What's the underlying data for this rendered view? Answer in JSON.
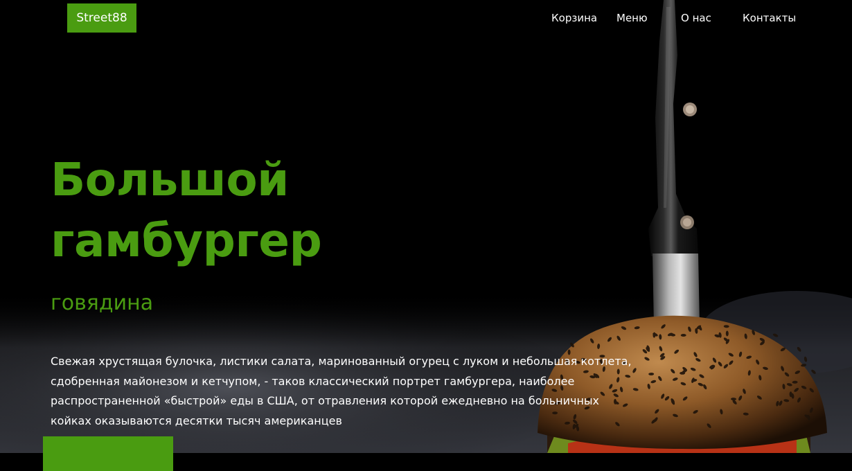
{
  "header": {
    "logo": "Street88",
    "nav": [
      "Корзина",
      "Меню",
      "О нас",
      "Контакты"
    ]
  },
  "hero": {
    "title_line1": "Большой",
    "title_line2": "гамбургер",
    "subtitle": "говядина",
    "description": "Свежая хрустящая булочка, листики салата, маринованный огурец с луком и небольшая котлета, сдобренная майонезом и кетчупом, - таков классический портрет гамбургера, наиболее распространенной «быстрой» еды в США, от отравления которой ежедневно на больничных койках оказываются десятки тысяч американцев"
  },
  "colors": {
    "accent": "#4a9c11",
    "background": "#000000",
    "text": "#ffffff"
  }
}
